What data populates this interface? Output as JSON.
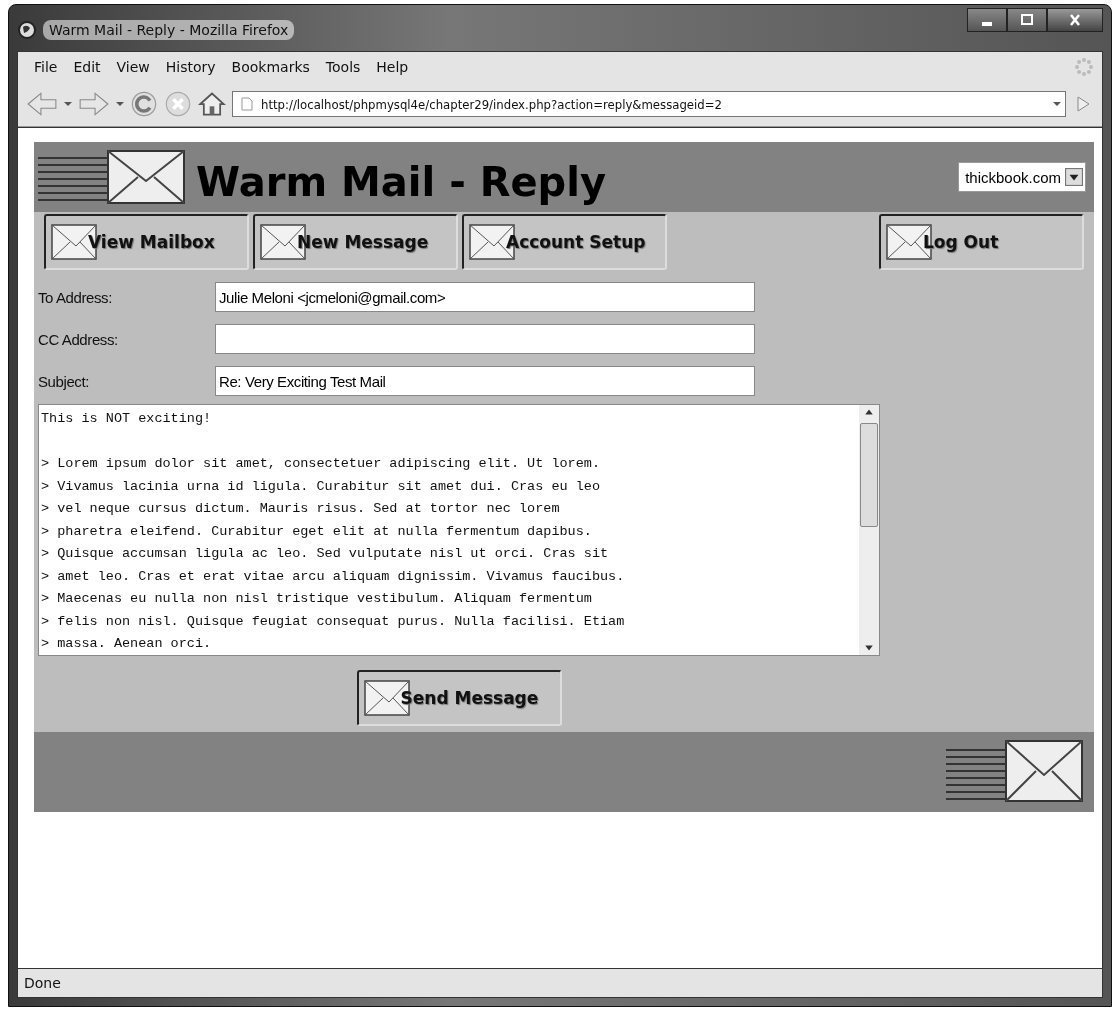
{
  "window": {
    "title": "Warm Mail - Reply - Mozilla Firefox"
  },
  "menu": [
    "File",
    "Edit",
    "View",
    "History",
    "Bookmarks",
    "Tools",
    "Help"
  ],
  "address_bar": {
    "url": "http://localhost/phpmysql4e/chapter29/index.php?action=reply&messageid=2"
  },
  "page": {
    "heading": "Warm Mail - Reply",
    "account_select": "thickbook.com",
    "nav_buttons": [
      "View Mailbox",
      "New Message",
      "Account Setup"
    ],
    "logout_button": "Log Out",
    "fields": [
      {
        "label": "To Address:",
        "value": "Julie Meloni <jcmeloni@gmail.com>"
      },
      {
        "label": "CC Address:"
      },
      {
        "label": "Subject:",
        "value": "Re: Very Exciting Test Mail"
      }
    ],
    "body_opening": "This is NOT exciting!",
    "body": [
      "> Lorem ipsum dolor sit amet, consectetuer adipiscing elit. Ut lorem.",
      "> Vivamus lacinia urna id ligula. Curabitur sit amet dui. Cras eu leo",
      "> vel neque cursus dictum. Mauris risus. Sed at tortor nec lorem",
      "> pharetra eleifend. Curabitur eget elit at nulla fermentum dapibus.",
      "> Quisque accumsan ligula ac leo. Sed vulputate nisl ut orci. Cras sit",
      "> amet leo. Cras et erat vitae arcu aliquam dignissim. Vivamus faucibus.",
      "> Maecenas eu nulla non nisl tristique vestibulum. Aliquam fermentum",
      "> felis non nisl. Quisque feugiat consequat purus. Nulla facilisi. Etiam",
      "> massa. Aenean orci."
    ],
    "send_button": "Send Message"
  },
  "status_bar": "Done"
}
